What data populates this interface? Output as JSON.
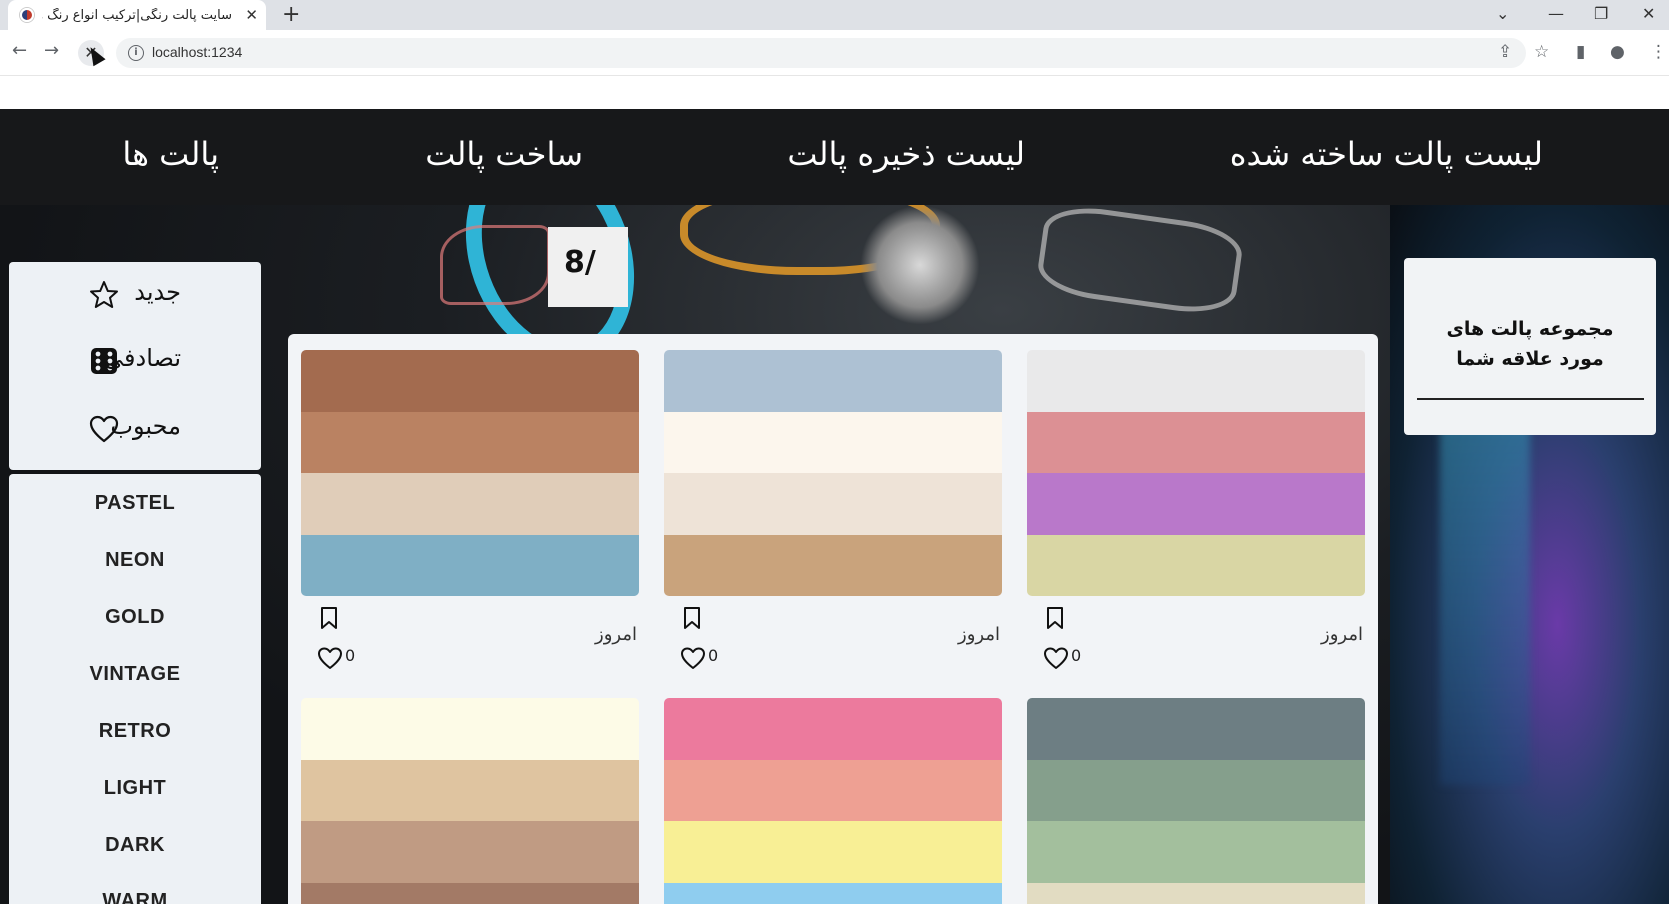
{
  "browser": {
    "tab_title": "سایت پالت رنگی|ترکیب انواع رنگ ها",
    "tab_close": "✕",
    "new_tab": "+",
    "url": "localhost:1234"
  },
  "nav": {
    "items": [
      "لیست پالت ساخته شده",
      "لیست ذخیره پالت",
      "ساخت پالت",
      "پالت ها"
    ]
  },
  "sidebar": {
    "filters": [
      {
        "label": "جدید",
        "icon": "star-icon"
      },
      {
        "label": "تصادفی",
        "icon": "dice-icon"
      },
      {
        "label": "محبوب",
        "icon": "heart-icon"
      }
    ],
    "categories": [
      "PASTEL",
      "NEON",
      "GOLD",
      "VINTAGE",
      "RETRO",
      "LIGHT",
      "DARK",
      "WARM"
    ]
  },
  "favorites": {
    "title": "مجموعه پالت های مورد علاقه شما"
  },
  "palettes": [
    {
      "colors": [
        "#e9e9ea",
        "#dc9094",
        "#b978ca",
        "#d9d6a4"
      ],
      "date": "امروز",
      "likes": "0"
    },
    {
      "colors": [
        "#adc1d3",
        "#fcf6ed",
        "#eee3d7",
        "#c9a37c"
      ],
      "date": "امروز",
      "likes": "0"
    },
    {
      "colors": [
        "#a36b4f",
        "#ba8262",
        "#e0cdb9",
        "#7fafc5"
      ],
      "date": "امروز",
      "likes": "0"
    },
    {
      "colors": [
        "#6d7e83",
        "#859f8c",
        "#a3bf9d",
        "#e2dcc2"
      ],
      "date": "",
      "likes": ""
    },
    {
      "colors": [
        "#ec7a9d",
        "#eea093",
        "#f8ef95",
        "#8fcdef"
      ],
      "date": "",
      "likes": ""
    },
    {
      "colors": [
        "#fdfbe7",
        "#dfc4a0",
        "#c09b83",
        "#a37a66"
      ],
      "date": "",
      "likes": ""
    }
  ]
}
